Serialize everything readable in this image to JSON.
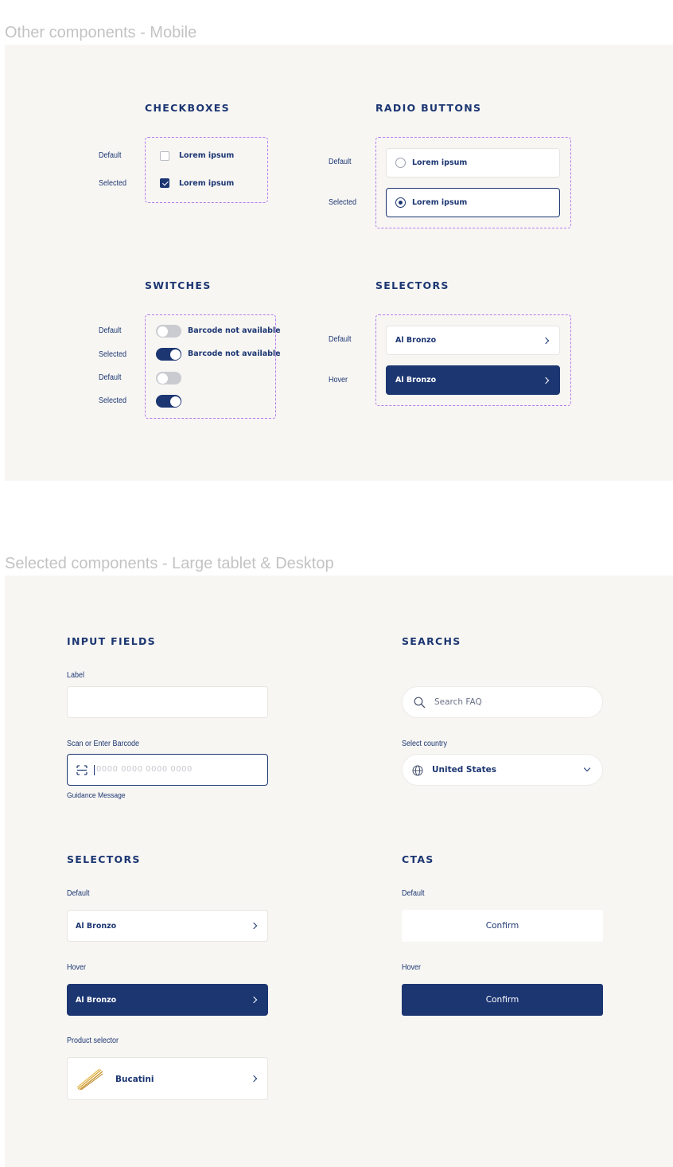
{
  "mobile_frame": {
    "title": "Other components - Mobile",
    "checkboxes": {
      "heading": "CHECKBOXES",
      "rows": [
        {
          "state": "Default",
          "label": "Lorem ipsum",
          "checked": false
        },
        {
          "state": "Selected",
          "label": "Lorem ipsum",
          "checked": true
        }
      ]
    },
    "radio_buttons": {
      "heading": "RADIO BUTTONS",
      "rows": [
        {
          "state": "Default",
          "label": "Lorem ipsum",
          "selected": false
        },
        {
          "state": "Selected",
          "label": "Lorem ipsum",
          "selected": true
        }
      ]
    },
    "switches": {
      "heading": "SWITCHES",
      "rows": [
        {
          "state": "Default",
          "label": "Barcode not available",
          "on": false
        },
        {
          "state": "Selected",
          "label": "Barcode not available",
          "on": true
        },
        {
          "state": "Default",
          "label": "",
          "on": false
        },
        {
          "state": "Selected",
          "label": "",
          "on": true
        }
      ]
    },
    "selectors": {
      "heading": "SELECTORS",
      "rows": [
        {
          "state": "Default",
          "label": "Al Bronzo"
        },
        {
          "state": "Hover",
          "label": "Al Bronzo"
        }
      ]
    }
  },
  "desktop_frame": {
    "title": "Selected components - Large tablet & Desktop",
    "input_fields": {
      "heading": "INPUT FIELDS",
      "label_field": {
        "label": "Label",
        "value": ""
      },
      "barcode_field": {
        "label": "Scan or Enter Barcode",
        "placeholder": "0000 0000 0000 0000",
        "guidance": "Guidance Message",
        "icon": "barcode-scan-icon"
      }
    },
    "searchs": {
      "heading": "SEARCHS",
      "search": {
        "placeholder": "Search FAQ",
        "icon": "search-icon"
      },
      "country": {
        "label": "Select country",
        "value": "United States",
        "icon": "globe-icon"
      }
    },
    "selectors": {
      "heading": "SELECTORS",
      "default": {
        "state": "Default",
        "label": "Al Bronzo"
      },
      "hover": {
        "state": "Hover",
        "label": "Al Bronzo"
      },
      "product": {
        "state": "Product selector",
        "label": "Bucatini",
        "icon": "pasta-icon"
      }
    },
    "ctas": {
      "heading": "CTAS",
      "default": {
        "state": "Default",
        "label": "Confirm"
      },
      "hover": {
        "state": "Hover",
        "label": "Confirm"
      }
    }
  },
  "colors": {
    "navy": "#1c3672",
    "panel_bg": "#f7f6f3",
    "dashed_outline": "#b57bf0",
    "frame_title": "#c3c3c3"
  }
}
